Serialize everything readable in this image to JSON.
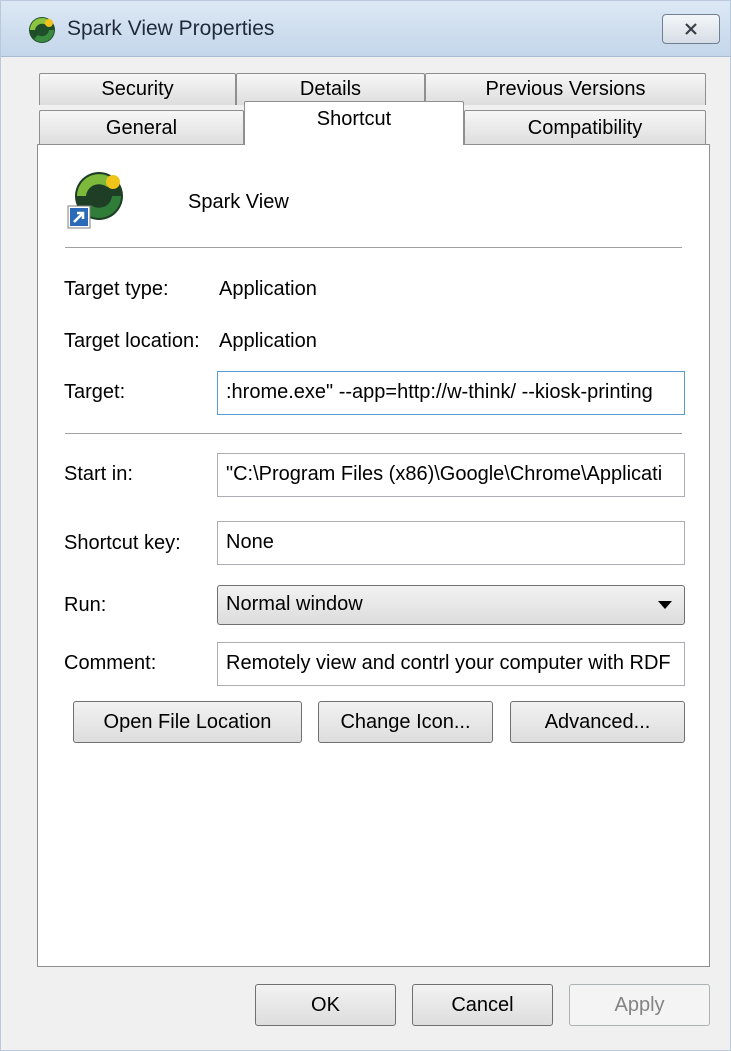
{
  "window": {
    "title": "Spark View Properties",
    "close_icon": "close-icon"
  },
  "tabs": {
    "row1": [
      "Security",
      "Details",
      "Previous Versions"
    ],
    "row2": [
      "General",
      "Shortcut",
      "Compatibility"
    ],
    "active": "Shortcut"
  },
  "shortcut": {
    "app_name": "Spark View",
    "target_type_label": "Target type:",
    "target_type_value": "Application",
    "target_location_label": "Target location:",
    "target_location_value": "Application",
    "target_label": "Target:",
    "target_value": ":hrome.exe\" --app=http://w-think/ --kiosk-printing",
    "start_in_label": "Start in:",
    "start_in_value": "\"C:\\Program Files (x86)\\Google\\Chrome\\Applicati",
    "shortcut_key_label": "Shortcut key:",
    "shortcut_key_value": "None",
    "run_label": "Run:",
    "run_value": "Normal window",
    "comment_label": "Comment:",
    "comment_value": "Remotely view and contrl your computer with RDF"
  },
  "actions": {
    "open_file_location": "Open File Location",
    "change_icon": "Change Icon...",
    "advanced": "Advanced..."
  },
  "footer": {
    "ok": "OK",
    "cancel": "Cancel",
    "apply": "Apply"
  },
  "colors": {
    "titlebar": "#c4d6ea",
    "dialog_bg": "#f0f0f0",
    "focus_border": "#5b9bd5"
  }
}
